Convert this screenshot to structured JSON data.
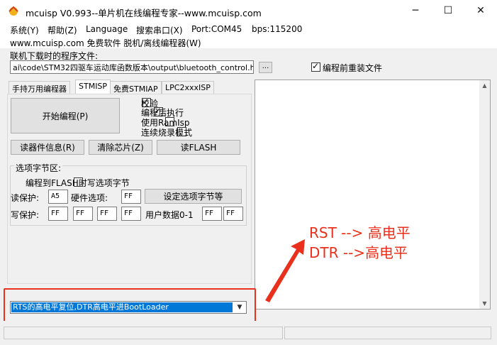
{
  "window": {
    "title": "mcuisp V0.993--单片机在线编程专家--www.mcuisp.com",
    "minimize": "─",
    "maximize": "☐",
    "close": "✕"
  },
  "menu": [
    "系统(Y)",
    "帮助(Z)",
    "Language",
    "搜索串口(X)",
    "Port:COM45",
    "bps:115200"
  ],
  "site_line": "www.mcuisp.com 免费软件 脱机/离线编程器(W)",
  "file": {
    "label": "联机下载时的程序文件:",
    "path": "ai\\code\\STM32四驱车运动库函数版本\\output\\bluetooth_control.hex",
    "browse": "...",
    "reload_label": "编程前重装文件"
  },
  "tabs": [
    "手持万用编程器",
    "STMISP",
    "免费STMIAP",
    "LPC2xxxISP"
  ],
  "panel": {
    "start_button": "开始编程(P)",
    "options": [
      {
        "label": "校验",
        "checked": true
      },
      {
        "label": "编程后执行",
        "checked": true
      },
      {
        "label": "使用RamIsp",
        "checked": false
      },
      {
        "label": "连续烧录模式",
        "checked": false
      }
    ],
    "read_info": "读器件信息(R)",
    "erase": "清除芯片(Z)",
    "read_flash": "读FLASH",
    "option_group_title": "选项字节区:",
    "write_opt_label": "编程到FLASH时写选项字节",
    "read_protect_label": "读保护:",
    "read_protect_value": "A5",
    "hw_option_label": "硬件选项:",
    "hw_option_value": "FF",
    "set_option_button": "设定选项字节等",
    "write_protect_label": "写保护:",
    "write_protect_values": [
      "FF",
      "FF",
      "FF",
      "FF"
    ],
    "user_data_label": "用户数据0-1",
    "user_data_values": [
      "FF",
      "FF"
    ]
  },
  "annotation": {
    "line1": "RST --> 高电平",
    "line2": "DTR -->高电平",
    "color": "#e8301c"
  },
  "boot_select": {
    "value": "RTS的高电平复位,DTR高电平进BootLoader"
  },
  "icons": [
    "app-logo-icon",
    "chevron-down-icon",
    "arrow-up-icon",
    "arrow-down-icon",
    "annotation-arrow-icon"
  ]
}
